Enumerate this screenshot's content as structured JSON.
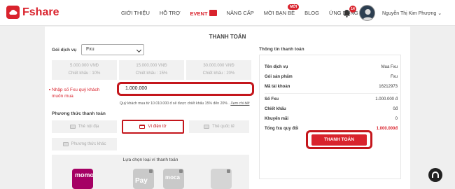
{
  "header": {
    "logo_text": "Fshare",
    "nav": [
      {
        "label": "GIỚI THIỆU"
      },
      {
        "label": "HỖ TRỢ"
      },
      {
        "label": "EVENT"
      },
      {
        "label": "NÂNG CẤP"
      },
      {
        "label": "MỜI BẠN BÈ",
        "badge": "MỚI"
      },
      {
        "label": "BLOG"
      },
      {
        "label": "ỨNG DỤNG"
      }
    ],
    "notification_count": "14",
    "username": "Nguyễn Thị Kim Phượng"
  },
  "payment": {
    "title": "THANH TOÁN",
    "service_label": "Gói dịch vụ",
    "service_value": "Fxu",
    "packages": [
      {
        "amount": "5.000.000 VNĐ",
        "discount": "Chiết khấu : 10%"
      },
      {
        "amount": "15.000.000 VNĐ",
        "discount": "Chiết khấu : 15%"
      },
      {
        "amount": "30.000.000 VNĐ",
        "discount": "Chiết khấu : 20%"
      }
    ],
    "custom_note": "Nhập số Fxu quý khách muốn mua",
    "amount_value": "1.000.000",
    "hint_text": "Quý khách mua từ 10.010.000 đ sẽ được chiết khấu 15% đến 20% .",
    "hint_link": "Xem chi tiết",
    "method_label": "Phương thức thanh toán",
    "methods": [
      {
        "label": "Thẻ nội địa"
      },
      {
        "label": "Ví điện tử"
      },
      {
        "label": "Thẻ quốc tế"
      },
      {
        "label": "Phương thức khác"
      }
    ],
    "wallet_title": "Lựa chọn loại ví thanh toán",
    "wallets": [
      {
        "name": "momo"
      },
      {
        "name": "Pay"
      },
      {
        "name": "moca"
      },
      {
        "name": ""
      }
    ]
  },
  "summary": {
    "title": "Thông tin thanh toán",
    "rows": [
      {
        "key": "Tên dịch vụ",
        "value": "Mua Fxu"
      },
      {
        "key": "Gói sản phẩm",
        "value": "Fxu"
      },
      {
        "key": "Mã tài khoản",
        "value": "16212973"
      },
      {
        "key": "Số Fxu",
        "value": "1.000.000 đ"
      },
      {
        "key": "Chiết khấu",
        "value": "0đ"
      },
      {
        "key": "Khuyến mãi",
        "value": "0"
      },
      {
        "key": "Tổng fxu quy đổi",
        "value": "1.000.000đ"
      }
    ],
    "pay_button": "THANH TOÁN"
  },
  "colors": {
    "brand": "#d9232d",
    "highlight": "#c4161c"
  }
}
